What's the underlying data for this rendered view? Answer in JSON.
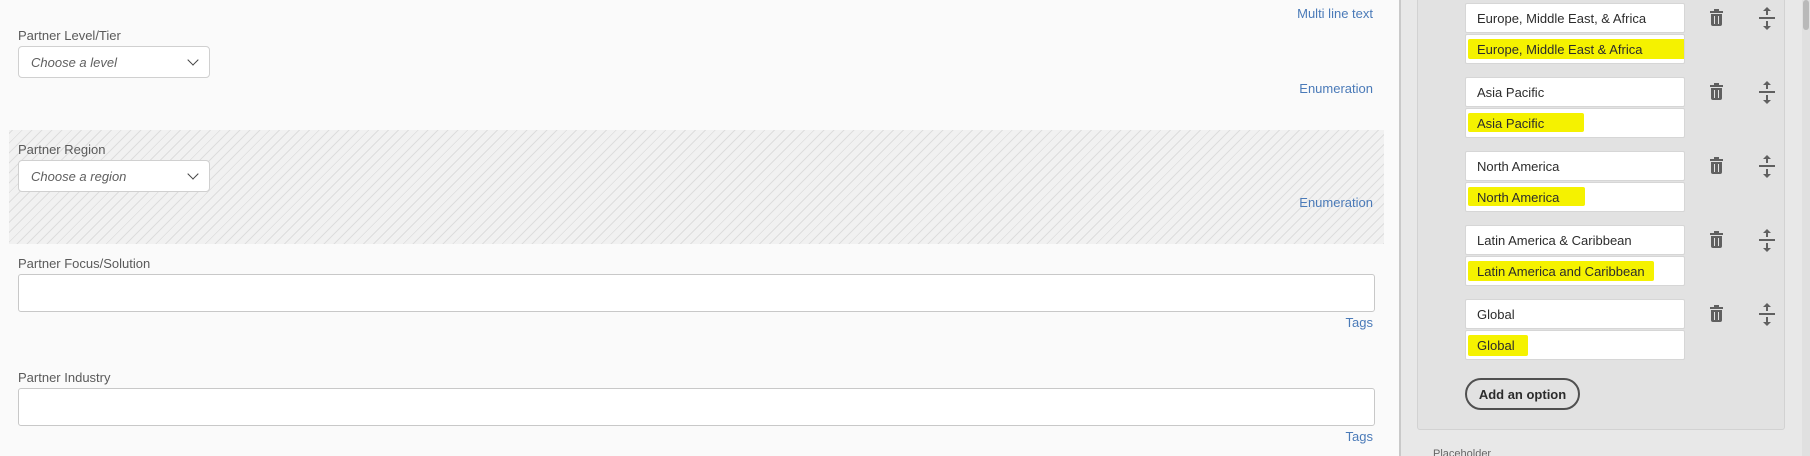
{
  "form": {
    "fields": [
      {
        "id": "level",
        "label": "Partner Level/Tier",
        "placeholder": "Choose a level",
        "type": "Enumeration"
      },
      {
        "id": "region",
        "label": "Partner Region",
        "placeholder": "Choose a region",
        "type": "Enumeration"
      },
      {
        "id": "focus",
        "label": "Partner Focus/Solution",
        "type": "Tags"
      },
      {
        "id": "industry",
        "label": "Partner Industry",
        "type": "Tags"
      }
    ],
    "top_type_label": "Multi line text"
  },
  "options_panel": {
    "options": [
      {
        "value": "Europe, Middle East, & Africa",
        "translation": "Europe, Middle East & Africa"
      },
      {
        "value": "Asia Pacific",
        "translation": "Asia Pacific"
      },
      {
        "value": "North America",
        "translation": "North America"
      },
      {
        "value": "Latin America & Caribbean",
        "translation": "Latin America and Caribbean"
      },
      {
        "value": "Global",
        "translation": "Global"
      }
    ],
    "add_option_label": "Add an option",
    "next_section_label": "Placeholder",
    "highlight_color": "#f5f200",
    "icons": [
      "trash-icon",
      "move-icon",
      "chevron-down-icon"
    ]
  }
}
